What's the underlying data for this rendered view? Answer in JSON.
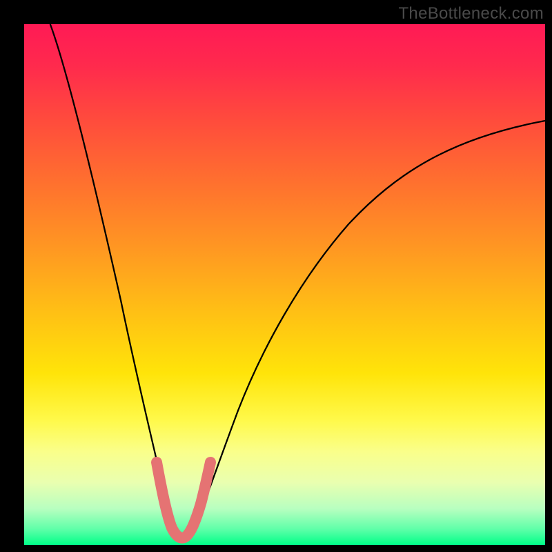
{
  "attribution": "TheBottleneck.com",
  "colors": {
    "frame": "#000000",
    "gradient_top": "#ff1a55",
    "gradient_mid": "#ffe409",
    "gradient_bottom": "#00ff88",
    "curve": "#000000",
    "highlight": "#e57373"
  },
  "chart_data": {
    "type": "line",
    "title": "",
    "xlabel": "",
    "ylabel": "",
    "xlim": [
      0,
      100
    ],
    "ylim": [
      0,
      100
    ],
    "series": [
      {
        "name": "bottleneck-curve",
        "x": [
          5,
          7,
          9,
          11,
          13,
          15,
          17,
          19,
          21,
          23,
          25,
          27,
          28,
          29,
          30,
          31,
          32,
          33,
          35,
          38,
          41,
          45,
          50,
          55,
          60,
          65,
          70,
          75,
          80,
          85,
          90,
          95,
          100
        ],
        "values": [
          100,
          93,
          86,
          79,
          72,
          64,
          56,
          48,
          40,
          31,
          21,
          12,
          7,
          3,
          2,
          2,
          3,
          6,
          12,
          22,
          30,
          38,
          46,
          53,
          59,
          64,
          68,
          71.5,
          74.5,
          77,
          79,
          80.5,
          81.5
        ]
      },
      {
        "name": "highlight-segment",
        "x": [
          25,
          26.5,
          28,
          29,
          30,
          31,
          32,
          33,
          34.5
        ],
        "values": [
          17,
          11,
          7,
          3,
          2,
          2,
          3,
          6,
          11
        ]
      }
    ],
    "annotations": []
  }
}
